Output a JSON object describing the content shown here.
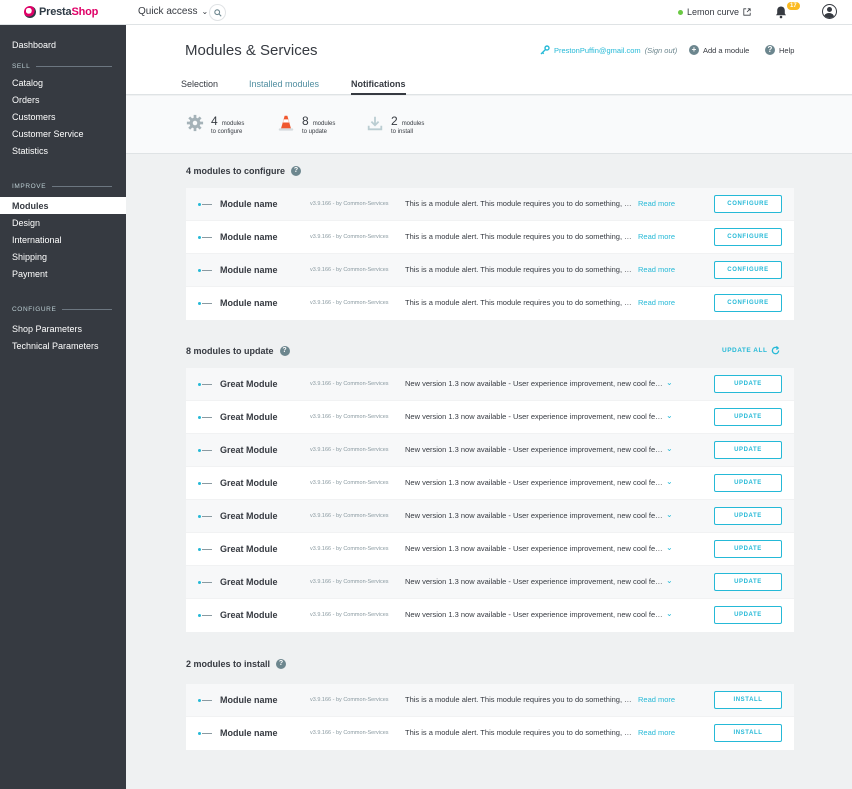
{
  "topbar": {
    "logo_presta": "Presta",
    "logo_shop": "Shop",
    "quick_access": "Quick access",
    "shop_name": "Lemon curve",
    "notification_count": "17"
  },
  "sidebar": {
    "items": [
      {
        "label": "Dashboard"
      },
      {
        "label": "Catalog"
      },
      {
        "label": "Orders"
      },
      {
        "label": "Customers"
      },
      {
        "label": "Customer Service"
      },
      {
        "label": "Statistics"
      },
      {
        "label": "Modules"
      },
      {
        "label": "Design"
      },
      {
        "label": "International"
      },
      {
        "label": "Shipping"
      },
      {
        "label": "Payment"
      },
      {
        "label": "Shop Parameters"
      },
      {
        "label": "Technical Parameters"
      }
    ],
    "sections": {
      "sell": "SELL",
      "improve": "IMPROVE",
      "configure": "CONFIGURE"
    }
  },
  "header": {
    "title": "Modules & Services",
    "email": "PrestonPuffin@gmail.com",
    "sign_out": "(Sign out)",
    "add_module": "Add a module",
    "help": "Help",
    "tabs": [
      {
        "label": "Selection"
      },
      {
        "label": "Installed modules"
      },
      {
        "label": "Notifications"
      }
    ]
  },
  "kpis": [
    {
      "count": "4",
      "line1": "modules",
      "line2": "to configure"
    },
    {
      "count": "8",
      "line1": "modules",
      "line2": "to update"
    },
    {
      "count": "2",
      "line1": "modules",
      "line2": "to install"
    }
  ],
  "configure": {
    "title": "4 modules to configure",
    "button": "CONFIGURE",
    "read_more": "Read more",
    "rows": [
      {
        "name": "Module name",
        "version": "v3.9.166 - by Common-Services",
        "message": "This is a module alert. This module requires you to do something, it..."
      },
      {
        "name": "Module name",
        "version": "v3.9.166 - by Common-Services",
        "message": "This is a module alert. This module requires you to do something, it..."
      },
      {
        "name": "Module name",
        "version": "v3.9.166 - by Common-Services",
        "message": "This is a module alert. This module requires you to do something, it..."
      },
      {
        "name": "Module name",
        "version": "v3.9.166 - by Common-Services",
        "message": "This is a module alert. This module requires you to do something, it..."
      }
    ]
  },
  "update": {
    "title": "8 modules to update",
    "update_all": "UPDATE ALL",
    "button": "UPDATE",
    "rows": [
      {
        "name": "Great Module",
        "version": "v3.9.166 - by Common-Services",
        "message": "New version 1.3 now available - User experience improvement, new cool feat..."
      },
      {
        "name": "Great Module",
        "version": "v3.9.166 - by Common-Services",
        "message": "New version 1.3 now available - User experience improvement, new cool feat..."
      },
      {
        "name": "Great Module",
        "version": "v3.9.166 - by Common-Services",
        "message": "New version 1.3 now available - User experience improvement, new cool feat..."
      },
      {
        "name": "Great Module",
        "version": "v3.9.166 - by Common-Services",
        "message": "New version 1.3 now available - User experience improvement, new cool feat..."
      },
      {
        "name": "Great Module",
        "version": "v3.9.166 - by Common-Services",
        "message": "New version 1.3 now available - User experience improvement, new cool feat..."
      },
      {
        "name": "Great Module",
        "version": "v3.9.166 - by Common-Services",
        "message": "New version 1.3 now available - User experience improvement, new cool feat..."
      },
      {
        "name": "Great Module",
        "version": "v3.9.166 - by Common-Services",
        "message": "New version 1.3 now available - User experience improvement, new cool feat..."
      },
      {
        "name": "Great Module",
        "version": "v3.9.166 - by Common-Services",
        "message": "New version 1.3 now available - User experience improvement, new cool feat..."
      }
    ]
  },
  "install": {
    "title": "2 modules to install",
    "button": "INSTALL",
    "read_more": "Read more",
    "rows": [
      {
        "name": "Module name",
        "version": "v3.9.166 - by Common-Services",
        "message": "This is a module alert. This module requires you to do something, it..."
      },
      {
        "name": "Module name",
        "version": "v3.9.166 - by Common-Services",
        "message": "This is a module alert. This module requires you to do something, it..."
      }
    ]
  },
  "colors": {
    "accent": "#25b9d7",
    "sidebar_bg": "#363a41",
    "brand_pink": "#df0067",
    "badge": "#fbbb22"
  }
}
